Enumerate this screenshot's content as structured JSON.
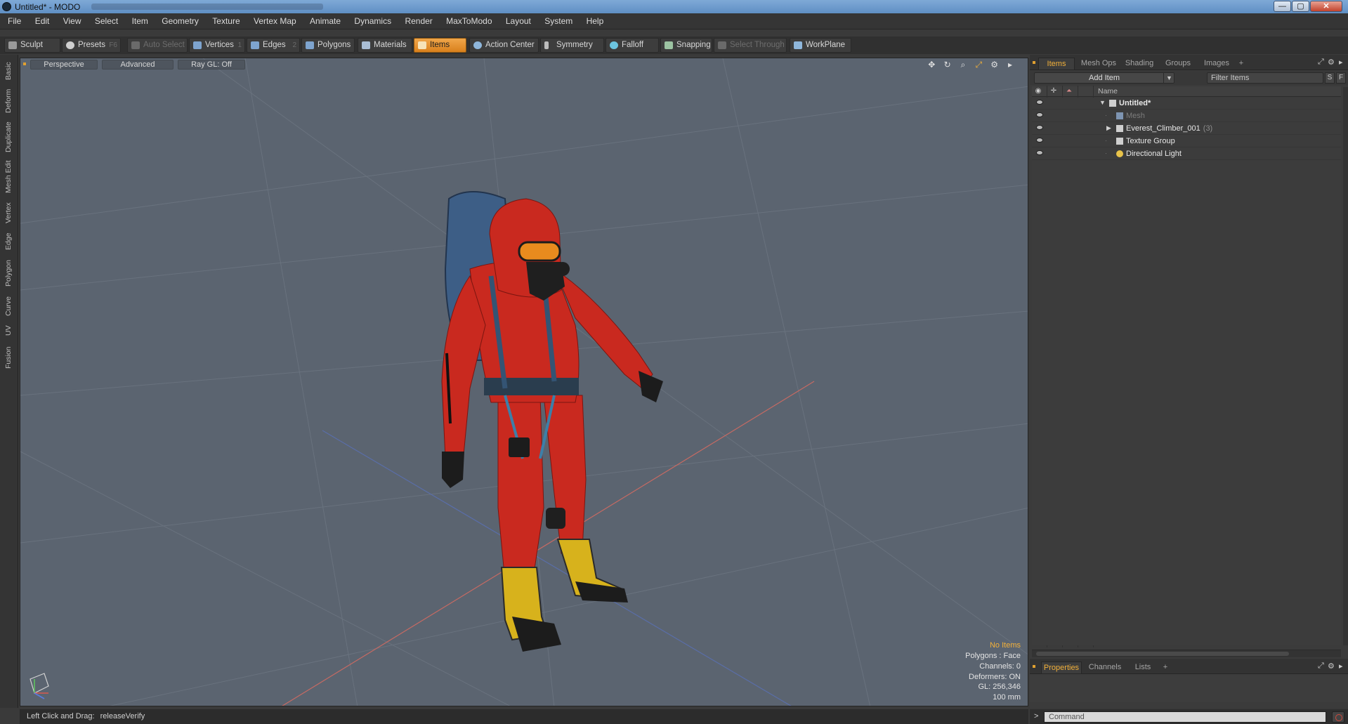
{
  "window": {
    "title": "Untitled* - MODO",
    "minimize": "—",
    "maximize": "▢",
    "close": "✕"
  },
  "menu": [
    "File",
    "Edit",
    "View",
    "Select",
    "Item",
    "Geometry",
    "Texture",
    "Vertex Map",
    "Animate",
    "Dynamics",
    "Render",
    "MaxToModo",
    "Layout",
    "System",
    "Help"
  ],
  "toolbar": {
    "sculpt": "Sculpt",
    "presets": "Presets",
    "presets_key": "F6",
    "auto_select": "Auto Select",
    "vertices": "Vertices",
    "vertices_key": "1",
    "edges": "Edges",
    "edges_key": "2",
    "polygons": "Polygons",
    "materials": "Materials",
    "items": "Items",
    "action_center": "Action Center",
    "symmetry": "Symmetry",
    "falloff": "Falloff",
    "snapping": "Snapping",
    "select_through": "Select Through",
    "workplane": "WorkPlane"
  },
  "left_tabs": [
    "Basic",
    "Deform",
    "Duplicate",
    "Mesh Edit",
    "Vertex",
    "Edge",
    "Polygon",
    "Curve",
    "UV",
    "Fusion"
  ],
  "viewport": {
    "view_mode": "Perspective",
    "shading": "Advanced",
    "raygl": "Ray GL: Off",
    "icons": [
      "move-icon",
      "rotate-icon",
      "zoom-icon",
      "maximize-icon",
      "gear-icon",
      "arrow-right-icon"
    ],
    "info": {
      "selection": "No Items",
      "polygons": "Polygons : Face",
      "channels": "Channels: 0",
      "deformers": "Deformers: ON",
      "gl": "GL: 256,346",
      "scale": "100 mm"
    },
    "colors": {
      "background": "#5b6470",
      "suit_red": "#c9291f",
      "backpack_blue": "#3d5e86",
      "boot_yellow": "#d7b21c",
      "goggle_orange": "#e98b1e"
    }
  },
  "right_panel": {
    "top_tabs": [
      "Items",
      "Mesh Ops",
      "Shading",
      "Groups",
      "Images"
    ],
    "add_tab": "+",
    "add_item": "Add Item",
    "filter_placeholder": "Filter Items",
    "filter_btn_s": "S",
    "filter_btn_f": "F",
    "column_name": "Name",
    "tree": [
      {
        "label": "Untitled*",
        "bold": true,
        "expanded": true,
        "level": 0,
        "icon": "scene-icon"
      },
      {
        "label": "Mesh",
        "dim": true,
        "level": 1,
        "icon": "mesh-icon"
      },
      {
        "label": "Everest_Climber_001",
        "count": "(3)",
        "collapsed": true,
        "level": 1,
        "icon": "group-icon"
      },
      {
        "label": "Texture Group",
        "level": 1,
        "icon": "texture-group-icon"
      },
      {
        "label": "Directional Light",
        "level": 1,
        "icon": "light-icon"
      }
    ],
    "bottom_tabs": [
      "Properties",
      "Channels",
      "Lists"
    ],
    "command_prompt": ">",
    "command_placeholder": "Command"
  },
  "status": {
    "label": "Left Click and Drag:",
    "value": "releaseVerify"
  }
}
